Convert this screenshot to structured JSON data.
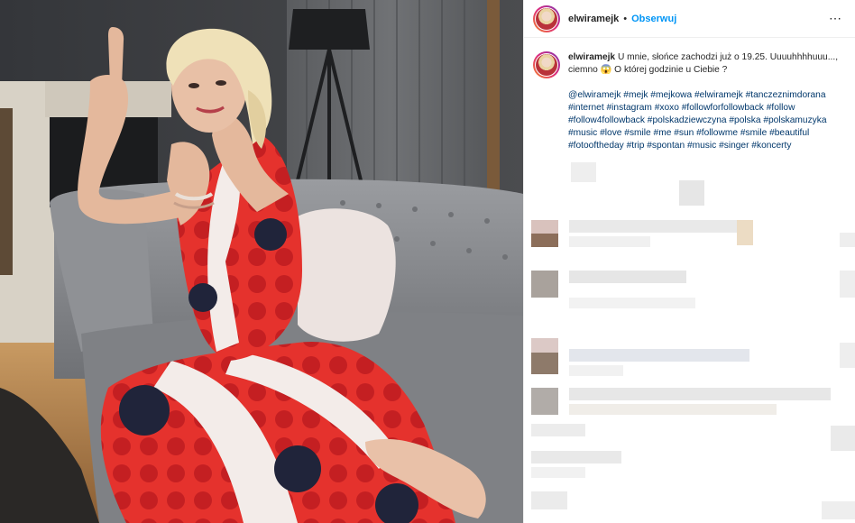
{
  "post": {
    "username": "elwiramejk",
    "follow_label": "Obserwuj",
    "separator": "•",
    "more_icon": "⋯"
  },
  "caption": {
    "username": "elwiramejk",
    "text": "U mnie, słońce zachodzi już o 19.25. Uuuuhhhhuuu..., ciemno 😱 O której godzinie u Ciebie ?",
    "hashtags": "@elwiramejk #mejk #mejkowa #elwiramejk #tanczeznimdorana #internet #instagram #xoxo #followforfollowback #follow #follow4followback #polskadziewczyna #polska #polskamuzyka #music #love #smile #me #sun #followme #smile #beautiful #fotooftheday #trip #spontan #music #singer #koncerty"
  },
  "colors": {
    "link": "#00376b",
    "follow": "#0095f6",
    "dress_red": "#e5322d",
    "dress_navy": "#20243a"
  }
}
